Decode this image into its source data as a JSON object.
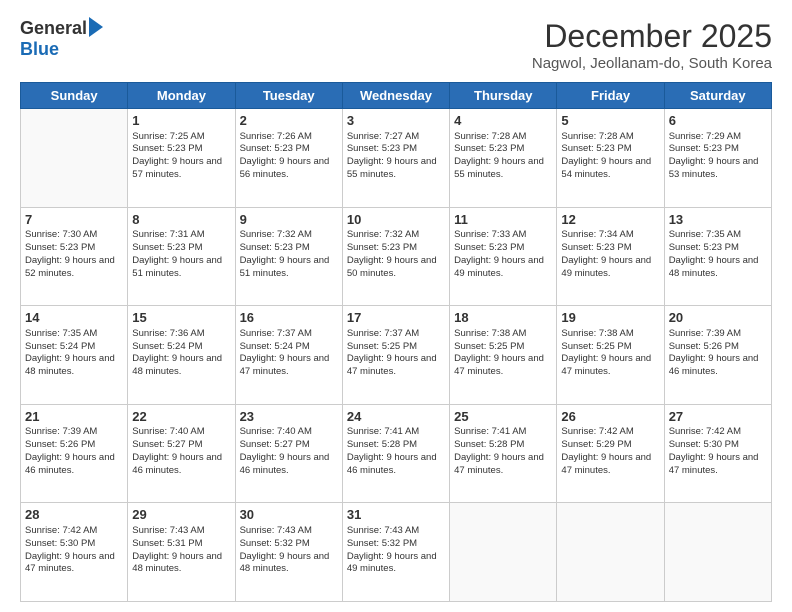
{
  "logo": {
    "general": "General",
    "blue": "Blue"
  },
  "header": {
    "month": "December 2025",
    "location": "Nagwol, Jeollanam-do, South Korea"
  },
  "days": [
    "Sunday",
    "Monday",
    "Tuesday",
    "Wednesday",
    "Thursday",
    "Friday",
    "Saturday"
  ],
  "weeks": [
    [
      {
        "num": "",
        "sunrise": "",
        "sunset": "",
        "daylight": "",
        "empty": true
      },
      {
        "num": "1",
        "sunrise": "Sunrise: 7:25 AM",
        "sunset": "Sunset: 5:23 PM",
        "daylight": "Daylight: 9 hours and 57 minutes."
      },
      {
        "num": "2",
        "sunrise": "Sunrise: 7:26 AM",
        "sunset": "Sunset: 5:23 PM",
        "daylight": "Daylight: 9 hours and 56 minutes."
      },
      {
        "num": "3",
        "sunrise": "Sunrise: 7:27 AM",
        "sunset": "Sunset: 5:23 PM",
        "daylight": "Daylight: 9 hours and 55 minutes."
      },
      {
        "num": "4",
        "sunrise": "Sunrise: 7:28 AM",
        "sunset": "Sunset: 5:23 PM",
        "daylight": "Daylight: 9 hours and 55 minutes."
      },
      {
        "num": "5",
        "sunrise": "Sunrise: 7:28 AM",
        "sunset": "Sunset: 5:23 PM",
        "daylight": "Daylight: 9 hours and 54 minutes."
      },
      {
        "num": "6",
        "sunrise": "Sunrise: 7:29 AM",
        "sunset": "Sunset: 5:23 PM",
        "daylight": "Daylight: 9 hours and 53 minutes."
      }
    ],
    [
      {
        "num": "7",
        "sunrise": "Sunrise: 7:30 AM",
        "sunset": "Sunset: 5:23 PM",
        "daylight": "Daylight: 9 hours and 52 minutes."
      },
      {
        "num": "8",
        "sunrise": "Sunrise: 7:31 AM",
        "sunset": "Sunset: 5:23 PM",
        "daylight": "Daylight: 9 hours and 51 minutes."
      },
      {
        "num": "9",
        "sunrise": "Sunrise: 7:32 AM",
        "sunset": "Sunset: 5:23 PM",
        "daylight": "Daylight: 9 hours and 51 minutes."
      },
      {
        "num": "10",
        "sunrise": "Sunrise: 7:32 AM",
        "sunset": "Sunset: 5:23 PM",
        "daylight": "Daylight: 9 hours and 50 minutes."
      },
      {
        "num": "11",
        "sunrise": "Sunrise: 7:33 AM",
        "sunset": "Sunset: 5:23 PM",
        "daylight": "Daylight: 9 hours and 49 minutes."
      },
      {
        "num": "12",
        "sunrise": "Sunrise: 7:34 AM",
        "sunset": "Sunset: 5:23 PM",
        "daylight": "Daylight: 9 hours and 49 minutes."
      },
      {
        "num": "13",
        "sunrise": "Sunrise: 7:35 AM",
        "sunset": "Sunset: 5:23 PM",
        "daylight": "Daylight: 9 hours and 48 minutes."
      }
    ],
    [
      {
        "num": "14",
        "sunrise": "Sunrise: 7:35 AM",
        "sunset": "Sunset: 5:24 PM",
        "daylight": "Daylight: 9 hours and 48 minutes."
      },
      {
        "num": "15",
        "sunrise": "Sunrise: 7:36 AM",
        "sunset": "Sunset: 5:24 PM",
        "daylight": "Daylight: 9 hours and 48 minutes."
      },
      {
        "num": "16",
        "sunrise": "Sunrise: 7:37 AM",
        "sunset": "Sunset: 5:24 PM",
        "daylight": "Daylight: 9 hours and 47 minutes."
      },
      {
        "num": "17",
        "sunrise": "Sunrise: 7:37 AM",
        "sunset": "Sunset: 5:25 PM",
        "daylight": "Daylight: 9 hours and 47 minutes."
      },
      {
        "num": "18",
        "sunrise": "Sunrise: 7:38 AM",
        "sunset": "Sunset: 5:25 PM",
        "daylight": "Daylight: 9 hours and 47 minutes."
      },
      {
        "num": "19",
        "sunrise": "Sunrise: 7:38 AM",
        "sunset": "Sunset: 5:25 PM",
        "daylight": "Daylight: 9 hours and 47 minutes."
      },
      {
        "num": "20",
        "sunrise": "Sunrise: 7:39 AM",
        "sunset": "Sunset: 5:26 PM",
        "daylight": "Daylight: 9 hours and 46 minutes."
      }
    ],
    [
      {
        "num": "21",
        "sunrise": "Sunrise: 7:39 AM",
        "sunset": "Sunset: 5:26 PM",
        "daylight": "Daylight: 9 hours and 46 minutes."
      },
      {
        "num": "22",
        "sunrise": "Sunrise: 7:40 AM",
        "sunset": "Sunset: 5:27 PM",
        "daylight": "Daylight: 9 hours and 46 minutes."
      },
      {
        "num": "23",
        "sunrise": "Sunrise: 7:40 AM",
        "sunset": "Sunset: 5:27 PM",
        "daylight": "Daylight: 9 hours and 46 minutes."
      },
      {
        "num": "24",
        "sunrise": "Sunrise: 7:41 AM",
        "sunset": "Sunset: 5:28 PM",
        "daylight": "Daylight: 9 hours and 46 minutes."
      },
      {
        "num": "25",
        "sunrise": "Sunrise: 7:41 AM",
        "sunset": "Sunset: 5:28 PM",
        "daylight": "Daylight: 9 hours and 47 minutes."
      },
      {
        "num": "26",
        "sunrise": "Sunrise: 7:42 AM",
        "sunset": "Sunset: 5:29 PM",
        "daylight": "Daylight: 9 hours and 47 minutes."
      },
      {
        "num": "27",
        "sunrise": "Sunrise: 7:42 AM",
        "sunset": "Sunset: 5:30 PM",
        "daylight": "Daylight: 9 hours and 47 minutes."
      }
    ],
    [
      {
        "num": "28",
        "sunrise": "Sunrise: 7:42 AM",
        "sunset": "Sunset: 5:30 PM",
        "daylight": "Daylight: 9 hours and 47 minutes."
      },
      {
        "num": "29",
        "sunrise": "Sunrise: 7:43 AM",
        "sunset": "Sunset: 5:31 PM",
        "daylight": "Daylight: 9 hours and 48 minutes."
      },
      {
        "num": "30",
        "sunrise": "Sunrise: 7:43 AM",
        "sunset": "Sunset: 5:32 PM",
        "daylight": "Daylight: 9 hours and 48 minutes."
      },
      {
        "num": "31",
        "sunrise": "Sunrise: 7:43 AM",
        "sunset": "Sunset: 5:32 PM",
        "daylight": "Daylight: 9 hours and 49 minutes."
      },
      {
        "num": "",
        "sunrise": "",
        "sunset": "",
        "daylight": "",
        "empty": true
      },
      {
        "num": "",
        "sunrise": "",
        "sunset": "",
        "daylight": "",
        "empty": true
      },
      {
        "num": "",
        "sunrise": "",
        "sunset": "",
        "daylight": "",
        "empty": true
      }
    ]
  ]
}
